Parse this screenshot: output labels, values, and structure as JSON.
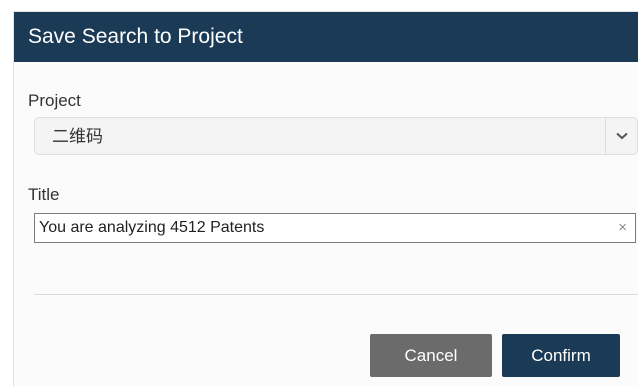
{
  "dialog": {
    "title": "Save Search to Project"
  },
  "project": {
    "label": "Project",
    "selected_value": "二维码",
    "toggle_icon": "chevron-down-icon"
  },
  "title_field": {
    "label": "Title",
    "value": "You are analyzing 4512 Patents",
    "clear_icon_glyph": "×"
  },
  "buttons": {
    "cancel_label": "Cancel",
    "confirm_label": "Confirm"
  },
  "colors": {
    "header_bg": "#1b3a55",
    "confirm_bg": "#1b3a55",
    "cancel_bg": "#6b6b6b"
  }
}
